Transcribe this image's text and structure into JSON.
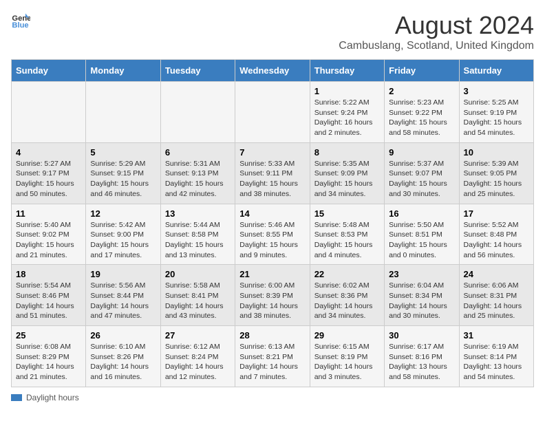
{
  "logo": {
    "line1": "General",
    "line2": "Blue"
  },
  "title": "August 2024",
  "subtitle": "Cambuslang, Scotland, United Kingdom",
  "days_of_week": [
    "Sunday",
    "Monday",
    "Tuesday",
    "Wednesday",
    "Thursday",
    "Friday",
    "Saturday"
  ],
  "legend_label": "Daylight hours",
  "weeks": [
    [
      {
        "day": "",
        "info": ""
      },
      {
        "day": "",
        "info": ""
      },
      {
        "day": "",
        "info": ""
      },
      {
        "day": "",
        "info": ""
      },
      {
        "day": "1",
        "info": "Sunrise: 5:22 AM\nSunset: 9:24 PM\nDaylight: 16 hours and 2 minutes."
      },
      {
        "day": "2",
        "info": "Sunrise: 5:23 AM\nSunset: 9:22 PM\nDaylight: 15 hours and 58 minutes."
      },
      {
        "day": "3",
        "info": "Sunrise: 5:25 AM\nSunset: 9:19 PM\nDaylight: 15 hours and 54 minutes."
      }
    ],
    [
      {
        "day": "4",
        "info": "Sunrise: 5:27 AM\nSunset: 9:17 PM\nDaylight: 15 hours and 50 minutes."
      },
      {
        "day": "5",
        "info": "Sunrise: 5:29 AM\nSunset: 9:15 PM\nDaylight: 15 hours and 46 minutes."
      },
      {
        "day": "6",
        "info": "Sunrise: 5:31 AM\nSunset: 9:13 PM\nDaylight: 15 hours and 42 minutes."
      },
      {
        "day": "7",
        "info": "Sunrise: 5:33 AM\nSunset: 9:11 PM\nDaylight: 15 hours and 38 minutes."
      },
      {
        "day": "8",
        "info": "Sunrise: 5:35 AM\nSunset: 9:09 PM\nDaylight: 15 hours and 34 minutes."
      },
      {
        "day": "9",
        "info": "Sunrise: 5:37 AM\nSunset: 9:07 PM\nDaylight: 15 hours and 30 minutes."
      },
      {
        "day": "10",
        "info": "Sunrise: 5:39 AM\nSunset: 9:05 PM\nDaylight: 15 hours and 25 minutes."
      }
    ],
    [
      {
        "day": "11",
        "info": "Sunrise: 5:40 AM\nSunset: 9:02 PM\nDaylight: 15 hours and 21 minutes."
      },
      {
        "day": "12",
        "info": "Sunrise: 5:42 AM\nSunset: 9:00 PM\nDaylight: 15 hours and 17 minutes."
      },
      {
        "day": "13",
        "info": "Sunrise: 5:44 AM\nSunset: 8:58 PM\nDaylight: 15 hours and 13 minutes."
      },
      {
        "day": "14",
        "info": "Sunrise: 5:46 AM\nSunset: 8:55 PM\nDaylight: 15 hours and 9 minutes."
      },
      {
        "day": "15",
        "info": "Sunrise: 5:48 AM\nSunset: 8:53 PM\nDaylight: 15 hours and 4 minutes."
      },
      {
        "day": "16",
        "info": "Sunrise: 5:50 AM\nSunset: 8:51 PM\nDaylight: 15 hours and 0 minutes."
      },
      {
        "day": "17",
        "info": "Sunrise: 5:52 AM\nSunset: 8:48 PM\nDaylight: 14 hours and 56 minutes."
      }
    ],
    [
      {
        "day": "18",
        "info": "Sunrise: 5:54 AM\nSunset: 8:46 PM\nDaylight: 14 hours and 51 minutes."
      },
      {
        "day": "19",
        "info": "Sunrise: 5:56 AM\nSunset: 8:44 PM\nDaylight: 14 hours and 47 minutes."
      },
      {
        "day": "20",
        "info": "Sunrise: 5:58 AM\nSunset: 8:41 PM\nDaylight: 14 hours and 43 minutes."
      },
      {
        "day": "21",
        "info": "Sunrise: 6:00 AM\nSunset: 8:39 PM\nDaylight: 14 hours and 38 minutes."
      },
      {
        "day": "22",
        "info": "Sunrise: 6:02 AM\nSunset: 8:36 PM\nDaylight: 14 hours and 34 minutes."
      },
      {
        "day": "23",
        "info": "Sunrise: 6:04 AM\nSunset: 8:34 PM\nDaylight: 14 hours and 30 minutes."
      },
      {
        "day": "24",
        "info": "Sunrise: 6:06 AM\nSunset: 8:31 PM\nDaylight: 14 hours and 25 minutes."
      }
    ],
    [
      {
        "day": "25",
        "info": "Sunrise: 6:08 AM\nSunset: 8:29 PM\nDaylight: 14 hours and 21 minutes."
      },
      {
        "day": "26",
        "info": "Sunrise: 6:10 AM\nSunset: 8:26 PM\nDaylight: 14 hours and 16 minutes."
      },
      {
        "day": "27",
        "info": "Sunrise: 6:12 AM\nSunset: 8:24 PM\nDaylight: 14 hours and 12 minutes."
      },
      {
        "day": "28",
        "info": "Sunrise: 6:13 AM\nSunset: 8:21 PM\nDaylight: 14 hours and 7 minutes."
      },
      {
        "day": "29",
        "info": "Sunrise: 6:15 AM\nSunset: 8:19 PM\nDaylight: 14 hours and 3 minutes."
      },
      {
        "day": "30",
        "info": "Sunrise: 6:17 AM\nSunset: 8:16 PM\nDaylight: 13 hours and 58 minutes."
      },
      {
        "day": "31",
        "info": "Sunrise: 6:19 AM\nSunset: 8:14 PM\nDaylight: 13 hours and 54 minutes."
      }
    ]
  ]
}
